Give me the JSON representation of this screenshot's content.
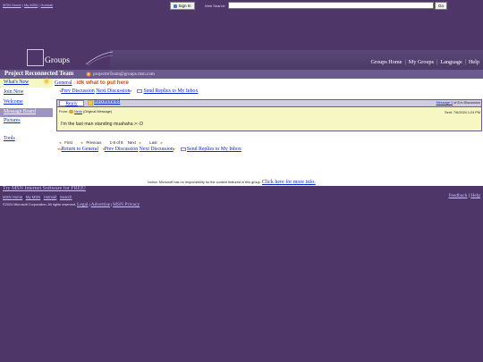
{
  "top_links": [
    "MSN Home",
    "My MSN",
    "Hotmail"
  ],
  "signin_label": "Sign In",
  "web_search": {
    "label": "Web Search:",
    "value": "",
    "go_label": "Go"
  },
  "brand": {
    "logo_text": "Groups"
  },
  "main_nav": [
    "Groups Home",
    "My Groups",
    "Language",
    "Help"
  ],
  "group": {
    "name": "Project Reconnected Team",
    "email": "projectreTeam@groups.msn.com"
  },
  "sidebar": {
    "items": [
      {
        "label": "What's New"
      },
      {
        "label": "Join Now"
      },
      {
        "label": "Welcome"
      },
      {
        "label": "Message Board",
        "selected": true
      },
      {
        "label": "Pictures"
      },
      {
        "label": "Tools"
      }
    ]
  },
  "breadcrumb": {
    "board": "General",
    "separator": ":",
    "topic": "idk what to put here"
  },
  "discussion_nav": {
    "prev": "Prev Discussion",
    "next": "Next Discussion",
    "send": "Send Replies to My Inbox"
  },
  "message": {
    "reply": "Reply",
    "recommend": "Recommend",
    "index_link": "Message 1",
    "index_rest": "of 8 in Discussion",
    "from_label": "From:",
    "author": "Nzdo",
    "original": "(Original Message)",
    "sent": "Sent: 7/6/2024 1:24 PM",
    "body": "I'm the last man standing muahaha >:-D"
  },
  "pager": {
    "first": "First",
    "previous": "Previous",
    "range": "1-8 of 8",
    "next": "Next",
    "last": "Last"
  },
  "bottom_nav": {
    "return": "Return to General",
    "prev": "Prev Discussion",
    "next": "Next Discussion",
    "send": "Send Replies to My Inbox"
  },
  "notice": {
    "text": "Notice: Microsoft has no responsibility for the content featured in this group.",
    "link": "Click here for more info."
  },
  "footer": {
    "msn_promo": "Try MSN Internet Software for FREE!",
    "links": [
      "MSN Home",
      "My MSN",
      "Hotmail",
      "Search"
    ],
    "right_links": [
      "Feedback",
      "Help"
    ],
    "copyright": "©2024 Microsoft Corporation. All rights reserved.",
    "legal_links": [
      "Legal",
      "Advertise",
      "MSN Privacy"
    ]
  },
  "colors": {
    "page_bg": "#4e3668",
    "header_band": "#6b5a8e",
    "message_bg": "#f7f7c4",
    "link": "#0a28c8",
    "accent": "#d04a10"
  }
}
